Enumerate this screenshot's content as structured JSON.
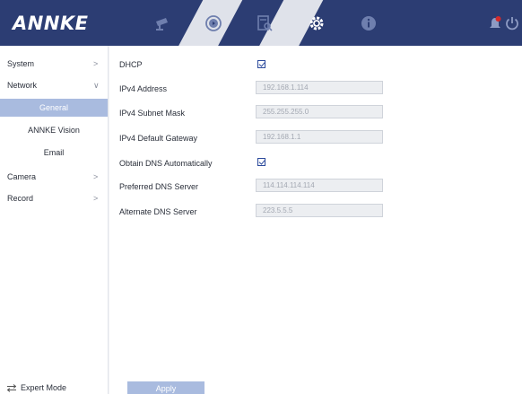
{
  "header": {
    "logo": "ANNKE",
    "nav_icons": [
      "camera-icon",
      "playback-icon",
      "search-icon",
      "gear-icon",
      "info-icon",
      "alarm-icon",
      "power-icon"
    ],
    "active_icon": "gear-icon",
    "background_color": "#2c3d73"
  },
  "sidebar": {
    "items": [
      {
        "label": "System",
        "chevron": ">"
      },
      {
        "label": "Network",
        "chevron": "∨"
      },
      {
        "label": "General"
      },
      {
        "label": "ANNKE Vision"
      },
      {
        "label": "Email"
      },
      {
        "label": "Camera",
        "chevron": ">"
      },
      {
        "label": "Record",
        "chevron": ">"
      }
    ],
    "selected": "General",
    "expert_mode": "Expert Mode",
    "selected_color": "#a9bbdf"
  },
  "form": {
    "dhcp_label": "DHCP",
    "dhcp_checked": true,
    "ipv4_address_label": "IPv4 Address",
    "ipv4_address_value": "192.168.1.114",
    "subnet_label": "IPv4 Subnet Mask",
    "subnet_value": "255.255.255.0",
    "gateway_label": "IPv4 Default Gateway",
    "gateway_value": "192.168.1.1",
    "obtain_dns_label": "Obtain DNS Automatically",
    "obtain_dns_checked": true,
    "preferred_dns_label": "Preferred DNS Server",
    "preferred_dns_value": "114.114.114.114",
    "alternate_dns_label": "Alternate DNS Server",
    "alternate_dns_value": "223.5.5.5",
    "apply_label": "Apply"
  }
}
